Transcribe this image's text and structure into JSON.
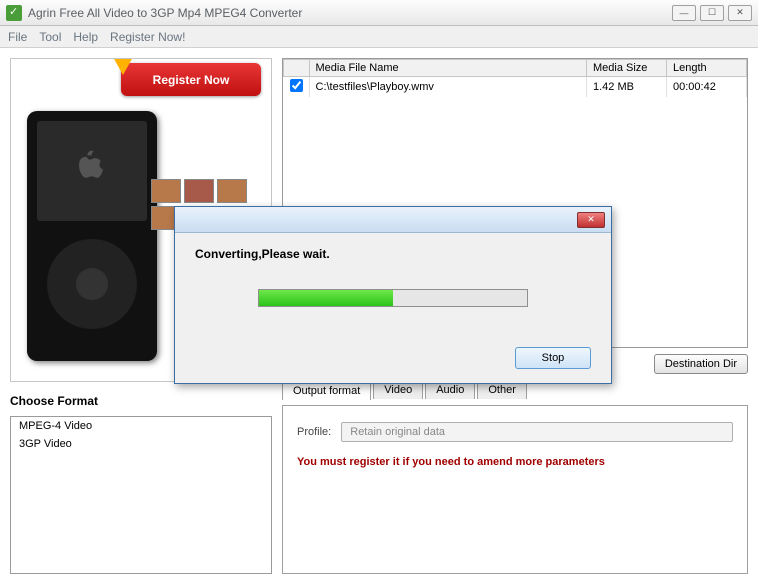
{
  "window": {
    "title": "Agrin Free All Video to 3GP Mp4 MPEG4 Converter"
  },
  "menu": {
    "file": "File",
    "tool": "Tool",
    "help": "Help",
    "register": "Register Now!"
  },
  "promo": {
    "register_label": "Register Now"
  },
  "choose_format_label": "Choose Format",
  "formats": [
    "MPEG-4 Video",
    "3GP Video"
  ],
  "filetable": {
    "headers": {
      "name": "Media File Name",
      "size": "Media Size",
      "length": "Length"
    },
    "rows": [
      {
        "checked": true,
        "name": "C:\\testfiles\\Playboy.wmv",
        "size": "1.42 MB",
        "length": "00:00:42"
      }
    ]
  },
  "buttons": {
    "destination": "Destination Dir"
  },
  "tabs": {
    "output": "Output format",
    "video": "Video",
    "audio": "Audio",
    "other": "Other"
  },
  "output": {
    "profile_label": "Profile:",
    "profile_value": "Retain original data",
    "warning": "You must register it if you need to amend more parameters"
  },
  "dialog": {
    "message": "Converting,Please wait.",
    "stop": "Stop",
    "progress_percent": 50
  }
}
